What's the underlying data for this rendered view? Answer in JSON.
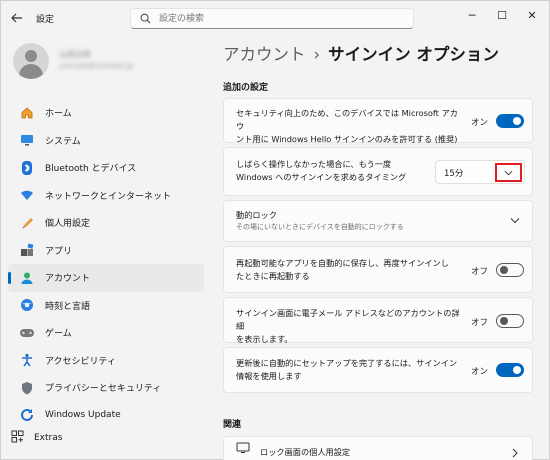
{
  "window": {
    "title": "設定",
    "minimize": "─",
    "maximize": "☐",
    "close": "✕"
  },
  "search": {
    "placeholder": "設定の検索"
  },
  "user": {
    "name": "山田太郎",
    "email": "yamada@example.jp"
  },
  "breadcrumb": {
    "parent": "アカウント",
    "separator": "›",
    "current": "サインイン オプション"
  },
  "nav": {
    "items": [
      {
        "label": "ホーム",
        "icon": "home-icon"
      },
      {
        "label": "システム",
        "icon": "system-icon"
      },
      {
        "label": "Bluetooth とデバイス",
        "icon": "bluetooth-icon"
      },
      {
        "label": "ネットワークとインターネット",
        "icon": "network-icon"
      },
      {
        "label": "個人用設定",
        "icon": "personalization-icon"
      },
      {
        "label": "アプリ",
        "icon": "apps-icon"
      },
      {
        "label": "アカウント",
        "icon": "account-icon",
        "active": true
      },
      {
        "label": "時刻と言語",
        "icon": "time-language-icon"
      },
      {
        "label": "ゲーム",
        "icon": "gaming-icon"
      },
      {
        "label": "アクセシビリティ",
        "icon": "accessibility-icon"
      },
      {
        "label": "プライバシーとセキュリティ",
        "icon": "privacy-icon"
      },
      {
        "label": "Windows Update",
        "icon": "windows-update-icon"
      }
    ],
    "extras": {
      "label": "Extras",
      "icon": "extras-icon"
    }
  },
  "sections": {
    "additional": "追加の設定",
    "related": "関連"
  },
  "settings": {
    "hello_only": {
      "line1": "セキュリティ向上のため、このデバイスでは Microsoft アカウ",
      "line2": "ント用に Windows Hello サインインのみを許可する (推奨)",
      "state": "オン"
    },
    "require_signin": {
      "line1": "しばらく操作しなかった場合に、もう一度",
      "line2": "Windows へのサインインを求めるタイミング",
      "value": "15分"
    },
    "dynamic_lock": {
      "title": "動的ロック",
      "subtitle": "その場にいないときにデバイスを自動的にロックする"
    },
    "restart_apps": {
      "line1": "再起動可能なアプリを自動的に保存し、再度サインインし",
      "line2": "たときに再起動する",
      "state": "オフ"
    },
    "show_account": {
      "line1": "サインイン画面に電子メール アドレスなどのアカウントの詳細",
      "line2": "を表示します。",
      "state": "オフ"
    },
    "use_signin_info": {
      "line1": "更新後に自動的にセットアップを完了するには、サインイン",
      "line2": "情報を使用します",
      "state": "オン"
    }
  },
  "related": {
    "lock_screen": "ロック画面の個人用設定"
  },
  "colors": {
    "accent": "#0067c0",
    "highlight": "#e02020"
  }
}
